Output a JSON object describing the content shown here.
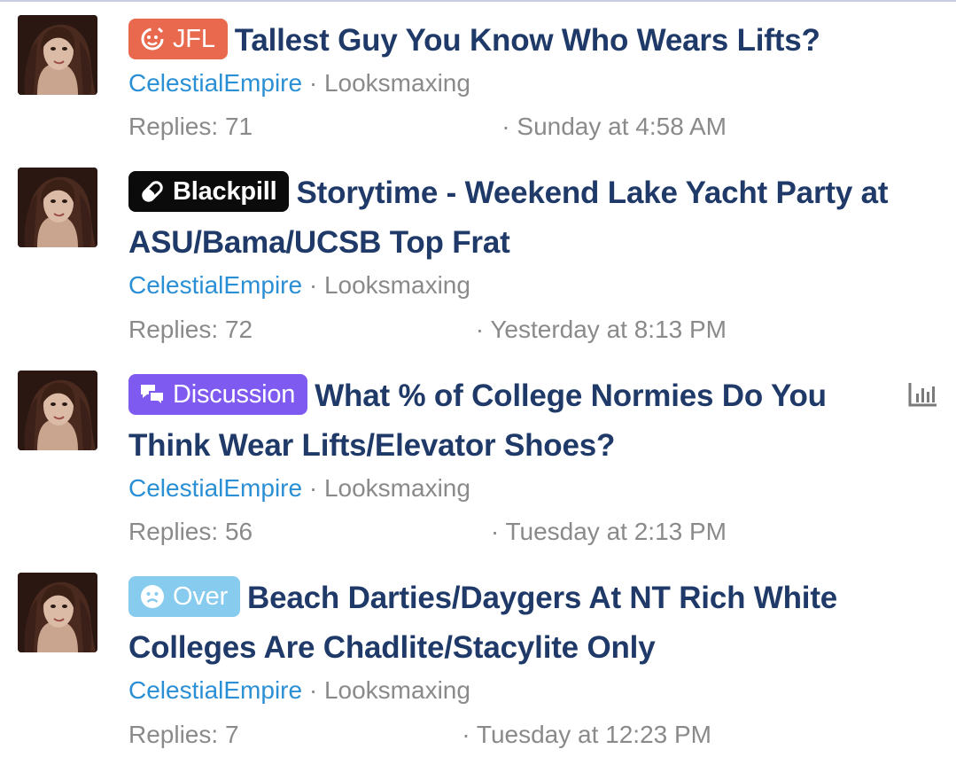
{
  "threads": [
    {
      "prefix": "JFL",
      "prefix_style": "jfl",
      "prefix_color": "#e8694e",
      "prefix_icon": "loading-face-icon",
      "title": "Tallest Guy You Know Who Wears Lifts?",
      "author": "CelestialEmpire",
      "forum": "Looksmaxing",
      "replies": "Replies: 71",
      "date": "Sunday at 4:58 AM",
      "has_poll": false
    },
    {
      "prefix": "Blackpill",
      "prefix_style": "blackpill",
      "prefix_color": "#0b0b0b",
      "prefix_icon": "pill-icon",
      "title": "Storytime - Weekend Lake Yacht Party at ASU/Bama/UCSB Top Frat",
      "author": "CelestialEmpire",
      "forum": "Looksmaxing",
      "replies": "Replies: 72",
      "date": "Yesterday at 8:13 PM",
      "has_poll": false
    },
    {
      "prefix": "Discussion",
      "prefix_style": "discussion",
      "prefix_color": "#7f5af0",
      "prefix_icon": "chat-bubbles-icon",
      "title": "What % of College Normies Do You Think Wear Lifts/Elevator Shoes?",
      "author": "CelestialEmpire",
      "forum": "Looksmaxing",
      "replies": "Replies: 56",
      "date": "Tuesday at 2:13 PM",
      "has_poll": true
    },
    {
      "prefix": "Over",
      "prefix_style": "over",
      "prefix_color": "#87cbee",
      "prefix_icon": "sad-face-icon",
      "title": "Beach Darties/Daygers At NT Rich White Colleges Are Chadlite/Stacylite Only",
      "author": "CelestialEmpire",
      "forum": "Looksmaxing",
      "replies": "Replies: 7",
      "date": "Tuesday at 12:23 PM",
      "has_poll": false
    }
  ],
  "separator": "·",
  "colors": {
    "title": "#1f3a68",
    "author": "#2a8fd4",
    "muted": "#8a8a8a"
  }
}
